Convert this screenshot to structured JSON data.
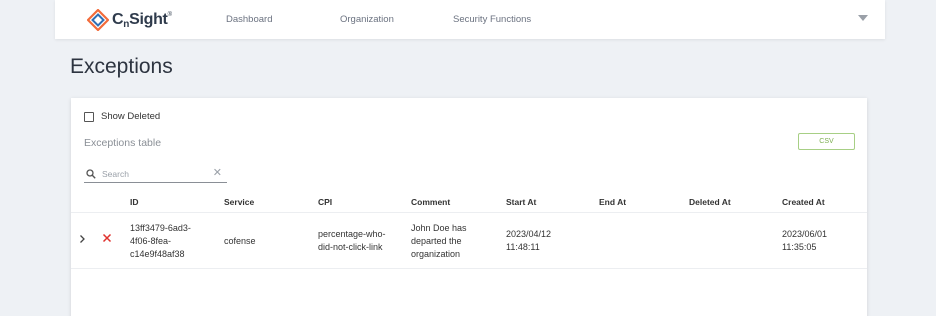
{
  "nav": {
    "logo_main": "C",
    "logo_sub": "n",
    "logo_rest": "Sight",
    "logo_mark": "®",
    "items": [
      {
        "label": "Dashboard"
      },
      {
        "label": "Organization"
      },
      {
        "label": "Security Functions"
      }
    ]
  },
  "page": {
    "title": "Exceptions"
  },
  "controls": {
    "show_deleted_label": "Show Deleted",
    "show_deleted_checked": false,
    "table_title": "Exceptions table",
    "csv_label": "CSV",
    "search_placeholder": "Search",
    "search_value": ""
  },
  "table": {
    "columns": [
      "ID",
      "Service",
      "CPI",
      "Comment",
      "Start At",
      "End At",
      "Deleted At",
      "Created At"
    ],
    "rows": [
      {
        "id": "13ff3479-6ad3-4f06-8fea-c14e9f48af38",
        "id_lines": [
          "13ff3479-6ad3-",
          "4f06-8fea-",
          "c14e9f48af38"
        ],
        "service": "cofense",
        "cpi_lines": [
          "percentage-who-",
          "did-not-click-link"
        ],
        "comment_lines": [
          "John Doe has",
          "departed the",
          "organization"
        ],
        "start_lines": [
          "2023/04/12",
          "11:48:11"
        ],
        "end_at": "",
        "deleted_at": "",
        "created_lines": [
          "2023/06/01",
          "11:35:05"
        ]
      }
    ]
  },
  "colors": {
    "accent_orange": "#f26b3a",
    "accent_blue": "#2f6fb5",
    "csv_green": "#7bae4f",
    "delete_red": "#e0322d"
  },
  "icons": {
    "logo": "cnsight-logo-icon",
    "caret": "chevron-down-icon",
    "search": "search-icon",
    "clear": "close-icon",
    "expand": "chevron-right-icon",
    "delete": "close-icon"
  }
}
